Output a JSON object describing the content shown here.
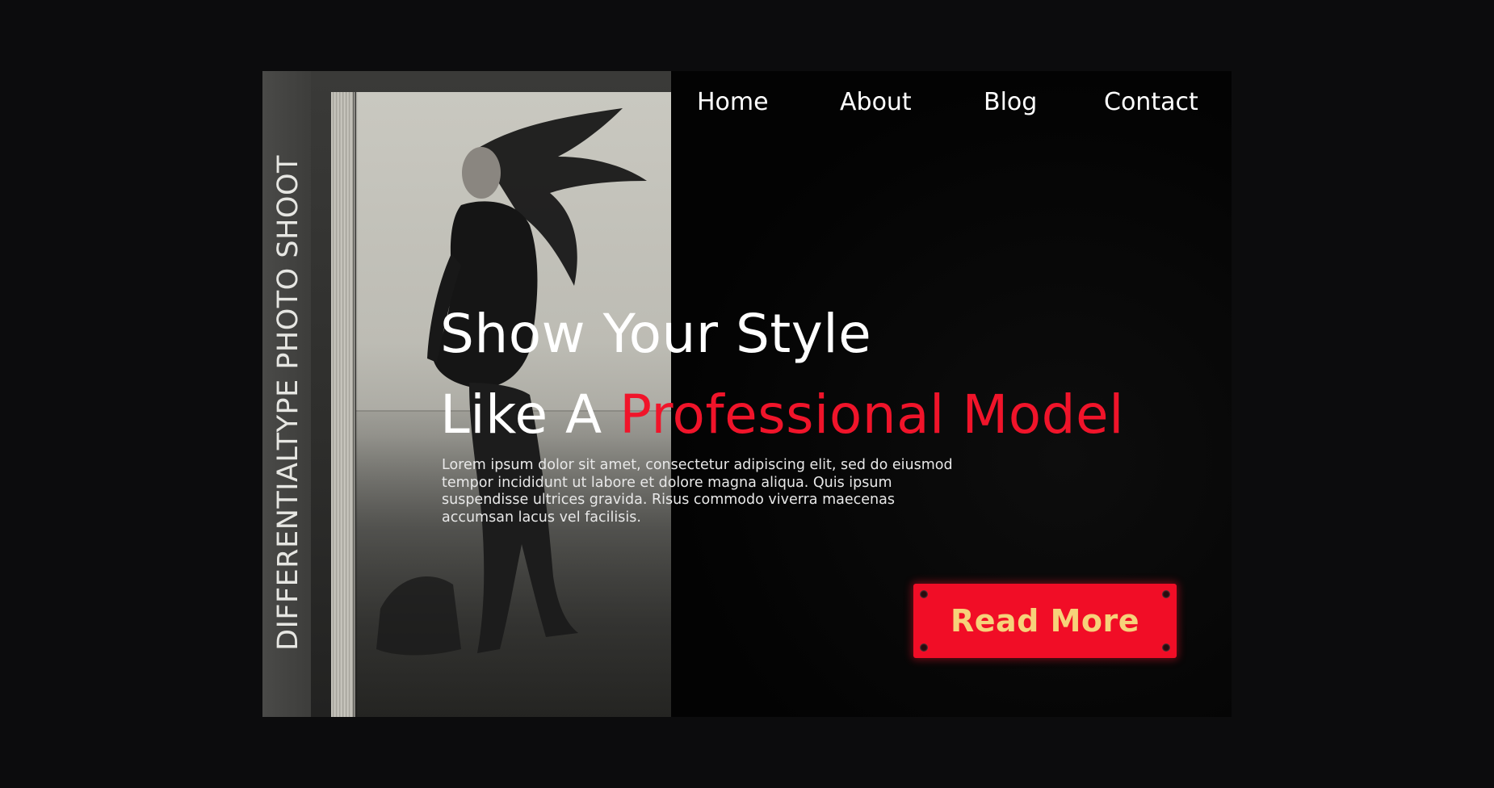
{
  "side_label": "DIFFERENTIALTYPE PHOTO SHOOT",
  "nav": {
    "items": [
      "Home",
      "About",
      "Blog",
      "Contact"
    ]
  },
  "hero": {
    "line1": "Show Your Style",
    "line2_prefix": "Like A ",
    "line2_accent": "Professional Model",
    "body": "Lorem ipsum dolor sit amet, consectetur adipiscing elit, sed do eiusmod tempor incididunt ut labore et dolore magna aliqua. Quis ipsum suspendisse ultrices gravida. Risus commodo viverra maecenas accumsan lacus vel facilisis.",
    "cta_label": "Read More"
  },
  "colors": {
    "accent": "#f0142a",
    "button_text": "#f6d27a",
    "background": "#030303"
  }
}
